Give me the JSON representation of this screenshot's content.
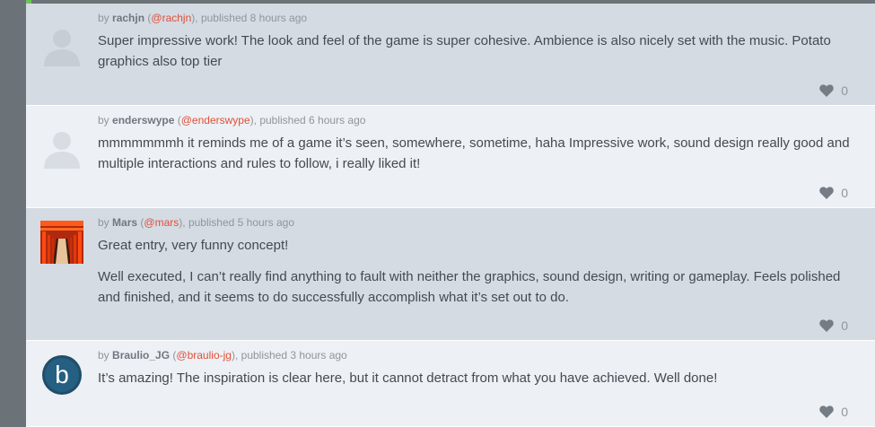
{
  "comments": [
    {
      "author": "rachjn",
      "handle": "@rachjn",
      "published": "published 8 hours ago",
      "paragraphs": [
        "Super impressive work! The look and feel of the game is super cohesive. Ambience is also nicely set with the music. Potato graphics also top tier"
      ],
      "likes": "0",
      "avatar": "default-avatar"
    },
    {
      "author": "enderswype",
      "handle": "@enderswype",
      "published": "published 6 hours ago",
      "paragraphs": [
        "mmmmmmmh it reminds me of a game it’s seen, somewhere, sometime, haha Impressive work, sound design really good and multiple interactions and rules to follow, i really liked it!"
      ],
      "likes": "0",
      "avatar": "default-avatar"
    },
    {
      "author": "Mars",
      "handle": "@mars",
      "published": "published 5 hours ago",
      "paragraphs": [
        "Great entry, very funny concept!",
        "Well executed, I can’t really find anything to fault with neither the graphics, sound design, writing or gameplay. Feels polished and finished, and it seems to do successfully accomplish what it’s set out to do."
      ],
      "likes": "0",
      "avatar": "torii-gate-photo"
    },
    {
      "author": "Braulio_JG",
      "handle": "@braulio-jg",
      "published": "published 3 hours ago",
      "paragraphs": [
        "It’s amazing! The inspiration is clear here, but it cannot detract from what you have achieved. Well done!"
      ],
      "likes": "0",
      "avatar": "letter-b-logo"
    }
  ],
  "labels": {
    "by": "by",
    "open_paren": "(",
    "close_paren": "),",
    "like_icon": "heart-icon"
  },
  "colors": {
    "handle": "#e0503a",
    "dark_row": "#d4dbe3",
    "light_row": "#edf0f4",
    "sidebar": "#6b7378",
    "accent": "#6dc45a"
  }
}
